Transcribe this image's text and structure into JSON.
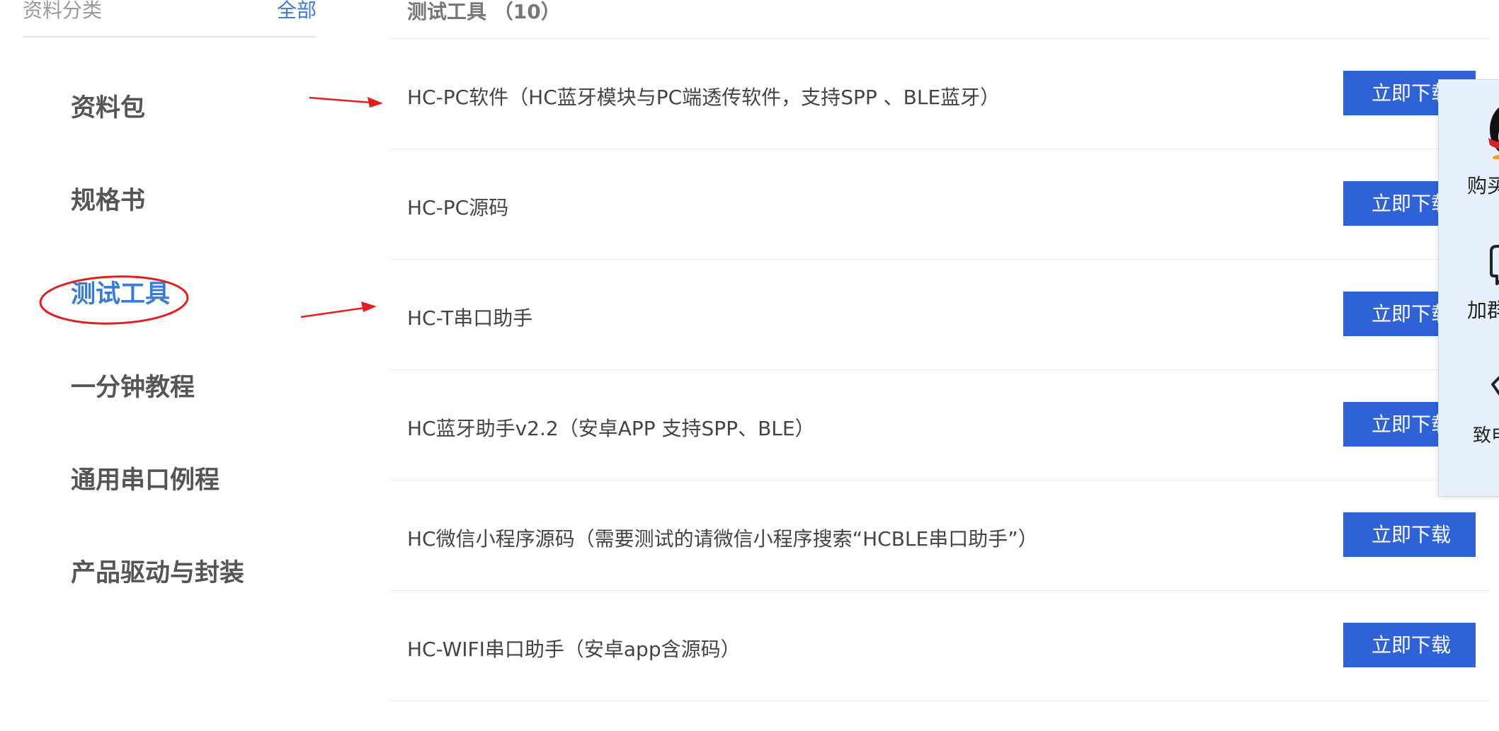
{
  "sidebar": {
    "title": "资料分类",
    "all_link": "全部",
    "categories": [
      {
        "label": "资料包",
        "active": false
      },
      {
        "label": "规格书",
        "active": false
      },
      {
        "label": "测试工具",
        "active": true
      },
      {
        "label": "一分钟教程",
        "active": false
      },
      {
        "label": "通用串口例程",
        "active": false
      },
      {
        "label": "产品驱动与封装",
        "active": false
      }
    ]
  },
  "main": {
    "section_title": "测试工具 （10）",
    "items": [
      {
        "name": "HC-PC软件（HC蓝牙模块与PC端透传软件，支持SPP 、BLE蓝牙）",
        "button": "立即下载"
      },
      {
        "name": "HC-PC源码",
        "button": "立即下载"
      },
      {
        "name": "HC-T串口助手",
        "button": "立即下载"
      },
      {
        "name": "HC蓝牙助手v2.2（安卓APP 支持SPP、BLE）",
        "button": "立即下载"
      },
      {
        "name": "HC微信小程序源码（需要测试的请微信小程序搜索“HCBLE串口助手”）",
        "button": "立即下载"
      },
      {
        "name": "HC-WIFI串口助手（安卓app含源码）",
        "button": "立即下载"
      }
    ]
  },
  "float_panel": {
    "items": [
      {
        "label": "购买",
        "icon": "qq-penguin-icon"
      },
      {
        "label": "加群",
        "icon": "chat-bubble-icon"
      },
      {
        "label": "致电",
        "icon": "phone-icon"
      }
    ]
  },
  "colors": {
    "accent": "#3a7bd5",
    "button_bg": "#2f62d7",
    "annotation": "#e02020",
    "panel_bg": "#e7f0fd"
  }
}
